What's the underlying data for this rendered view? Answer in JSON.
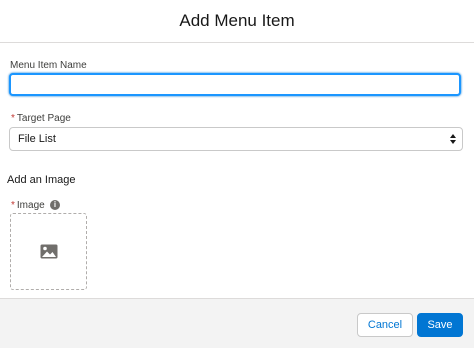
{
  "modal": {
    "title": "Add Menu Item"
  },
  "form": {
    "menu_item_name": {
      "label": "Menu Item Name",
      "value": "",
      "placeholder": ""
    },
    "target_page": {
      "required_mark": "*",
      "label": "Target Page",
      "selected": "File List"
    },
    "image_section": {
      "title": "Add an Image",
      "required_mark": "*",
      "label": "Image",
      "info_icon": "i"
    }
  },
  "footer": {
    "cancel_label": "Cancel",
    "save_label": "Save"
  },
  "colors": {
    "brand": "#0176d3",
    "focus_ring": "#1b96ff",
    "required": "#c23934"
  }
}
